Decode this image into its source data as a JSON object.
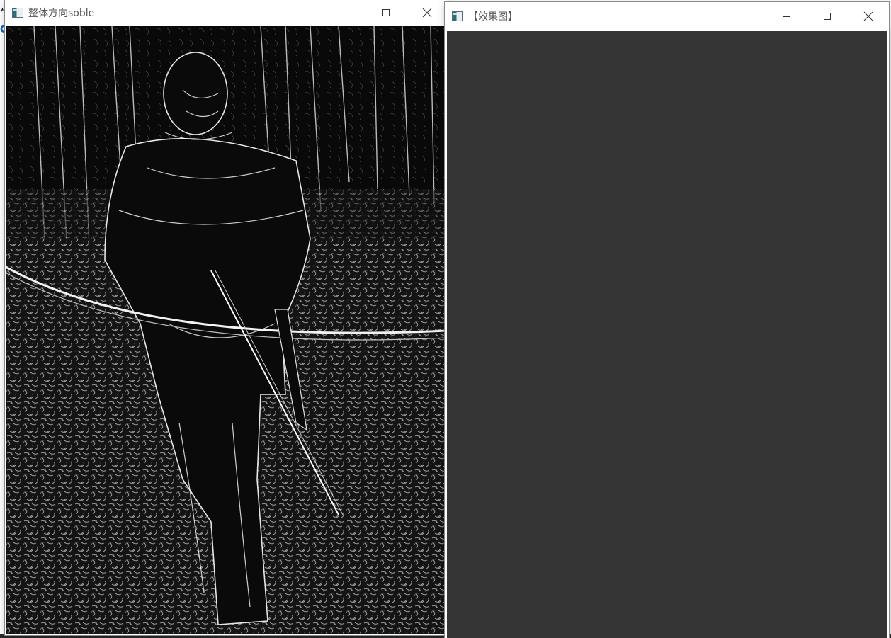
{
  "background": {
    "edge_glyph_top": "牛",
    "edge_glyph_blue": "C"
  },
  "windows": [
    {
      "title": "整体方向soble",
      "content": "sobel-edge-image"
    },
    {
      "title": "【效果图】",
      "content": "empty-dark-canvas"
    }
  ],
  "colors": {
    "titlebar_bg": "#ffffff",
    "image_bg": "#0b0b0b",
    "empty_canvas": "#353535"
  },
  "icons": {
    "app": "opencv-window-icon",
    "minimize": "minimize-icon",
    "maximize": "maximize-icon",
    "close": "close-icon"
  }
}
